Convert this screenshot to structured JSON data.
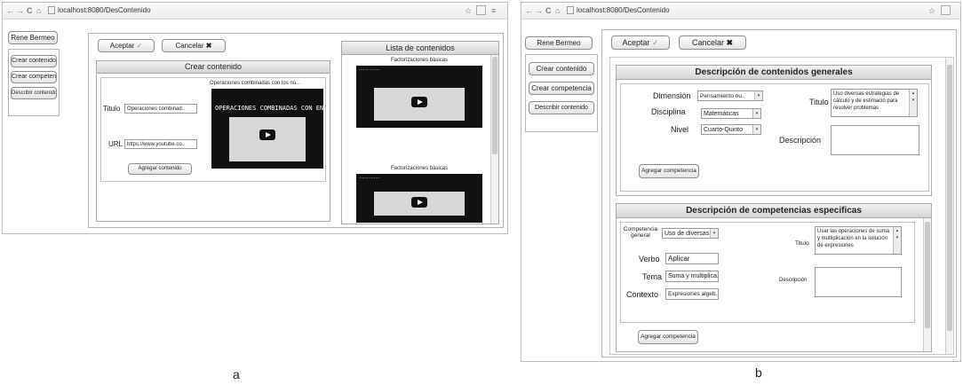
{
  "panel_a": {
    "browser": {
      "back": "←",
      "forward": "→",
      "reload": "C",
      "home": "⌂",
      "url": "localhost:8080/DesContenido",
      "star": "☆"
    },
    "user_button": "Rene Bermeo",
    "sidebar": [
      {
        "label": "Crear contenido"
      },
      {
        "label": "Crear competencia"
      },
      {
        "label": "Describir contenido"
      }
    ],
    "toolbar": {
      "accept": "Aceptar",
      "accept_icon": "✓",
      "cancel": "Cancelar",
      "cancel_icon": "✖"
    },
    "form": {
      "title": "Crear contenido",
      "titulo_label": "Titulo",
      "titulo_value": "Operaciones combinad..",
      "url_label": "URL",
      "url_value": "https://www.youtube.co..",
      "add_button": "Agregar contenido",
      "preview_title": "Operaciones combinadas con los nú...",
      "preview_banner": "OPERACIONES COMBINADAS CON ENTEROS"
    },
    "list": {
      "title": "Lista de contenidos",
      "items": [
        {
          "title": "Factorizaciones básicas"
        },
        {
          "title": "Factorizaciones básicas"
        }
      ]
    },
    "caption": "a"
  },
  "panel_b": {
    "browser": {
      "back": "←",
      "forward": "→",
      "reload": "C",
      "home": "⌂",
      "url": "localhost:8080/DesContenido",
      "star": "☆"
    },
    "user_button": "Rene Bermeo",
    "sidebar": [
      {
        "label": "Crear contenido"
      },
      {
        "label": "Crear competencia"
      },
      {
        "label": "Describir contenido"
      }
    ],
    "toolbar": {
      "accept": "Aceptar",
      "accept_icon": "✓",
      "cancel": "Cancelar",
      "cancel_icon": "✖"
    },
    "general": {
      "title": "Descripción de contenidos generales",
      "dimension_label": "Dimensión",
      "dimension_value": "Pensamiento nu..",
      "disciplina_label": "Disciplina",
      "disciplina_value": "Matemáticas",
      "nivel_label": "Nivel",
      "nivel_value": "Cuarto-Quinto",
      "titulo_label": "Titulo",
      "titulo_value": "Uso diversas estrategias de cálculo y de estimació para resolver problemas",
      "descripcion_label": "Descripción",
      "add_button": "Agregar competencia"
    },
    "specific": {
      "title": "Descripción de competencias especificas",
      "competencia_label": "Competencia general",
      "competencia_value": "Uso de diversas..",
      "titulo_label": "Titulo",
      "titulo_value": "Usar las operaciones de suma y multiplicación en la solución de expresiones",
      "verbo_label": "Verbo",
      "verbo_value": "Aplicar",
      "tema_label": "Tema",
      "tema_value": "Suma y multiplica..",
      "contexto_label": "Contexto",
      "contexto_value": "Expresiones algeb..",
      "descripcion_label": "Descripción",
      "add_button": "Agregar competencia"
    },
    "caption": "b"
  }
}
